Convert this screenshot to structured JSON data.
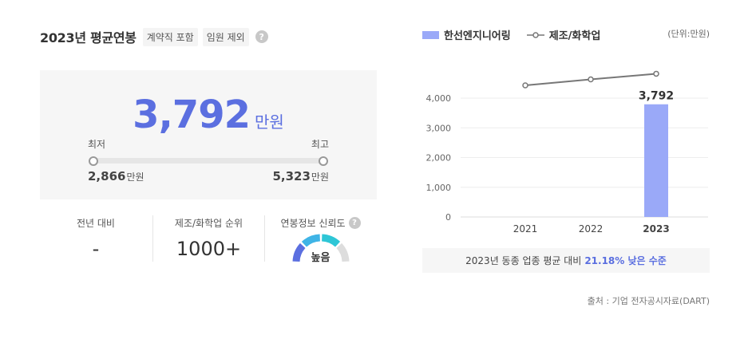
{
  "summary_section": {
    "title": "2023년 평균연봉",
    "tags": [
      "계약직 포함",
      "임원 제외"
    ],
    "help_glyph": "?"
  },
  "salary": {
    "value": "3,792",
    "unit": "만원",
    "min_label": "최저",
    "max_label": "최고",
    "min_value": "2,866",
    "max_value": "5,323",
    "value_unit": "만원"
  },
  "stats": [
    {
      "label": "전년 대비",
      "value": "-"
    },
    {
      "label": "제조/화학업 순위",
      "value": "1000+"
    },
    {
      "label": "연봉정보 신뢰도",
      "value": "높음"
    }
  ],
  "gauge_colors": [
    "#5b6fe0",
    "#3fb4e6",
    "#2ec6d6",
    "#dddddd"
  ],
  "legend": {
    "company": "한선엔지니어링",
    "industry": "제조/화학업",
    "unit_note": "(단위:만원)"
  },
  "chart_data": {
    "type": "bar",
    "categories": [
      "2021",
      "2022",
      "2023"
    ],
    "series": [
      {
        "name": "한선엔지니어링",
        "type": "bar",
        "values": [
          null,
          null,
          3792
        ],
        "color": "#9aa9f8"
      },
      {
        "name": "제조/화학업",
        "type": "line",
        "values": [
          4430,
          4630,
          4820
        ],
        "color": "#777777"
      }
    ],
    "bar_label": "3,792",
    "y_ticks": [
      "0",
      "1,000",
      "2,000",
      "3,000",
      "4,000"
    ],
    "ylim": [
      0,
      4000
    ],
    "grid": true,
    "title": "",
    "xlabel": "",
    "ylabel": ""
  },
  "comparison": {
    "text": "2023년 동종 업종 평균 대비",
    "highlight": "21.18% 낮은 수준"
  },
  "source": "출처 : 기업 전자공시자료(DART)"
}
